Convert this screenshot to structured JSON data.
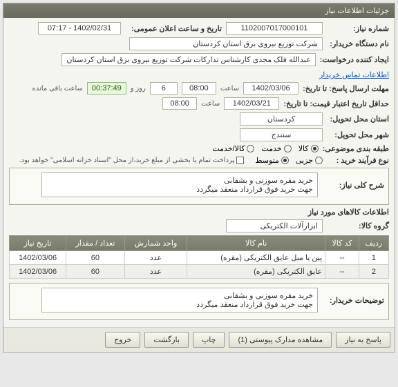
{
  "panel_title": "جزئیات اطلاعات نیاز",
  "fields": {
    "need_no_label": "شماره نیاز:",
    "need_no": "1102007017000101",
    "announce_label": "تاریخ و ساعت اعلان عمومی:",
    "announce_value": "1402/02/31 - 07:17",
    "buyer_label": "نام دستگاه خریدار:",
    "buyer_value": "شرکت توزیع نیروی برق استان کردستان",
    "requester_label": "ایجاد کننده درخواست:",
    "requester_value": "عبدالله فلک مجدی کارشناس تدارکات شرکت توزیع نیروی برق استان کردستان",
    "contact_link": "اطلاعات تماس خریدار",
    "deadline_label": "مهلت ارسال پاسخ: تا تاریخ:",
    "deadline_date": "1402/03/06",
    "time_label": "ساعت",
    "deadline_time": "08:00",
    "days_num": "6",
    "days_label": "روز و",
    "countdown": "00:37:49",
    "remaining": "ساعت باقی مانده",
    "validity_label": "حداقل تاریخ اعتبار قیمت: تا تاریخ:",
    "validity_date": "1402/03/21",
    "validity_time": "08:00",
    "province_label": "استان محل تحویل:",
    "province_value": "کردستان",
    "city_label": "شهر محل تحویل:",
    "city_value": "سنندج",
    "category_label": "طبقه بندی موضوعی:",
    "cat_goods": "کالا",
    "cat_service": "خدمت",
    "cat_goods_service": "کالا/خدمت",
    "process_label": "نوع فرآیند خرید :",
    "proc_small": "جزیی",
    "proc_medium": "متوسط",
    "payment_note": "پرداخت تمام یا بخشی از مبلغ خرید،از محل \"اسناد خزانه اسلامی\" خواهد بود.",
    "desc_label": "شرح کلی نیاز:",
    "desc_text": "خرید مقره سوزنی و بشقابی\nجهت خرید فوق قرارداد منعقد میگردد",
    "group_label": "گروه کالا:",
    "group_value": "ابزارآلات الکتریکی",
    "items_title": "اطلاعات کالاهای مورد نیاز",
    "buyer_notes_label": "توضیحات خریدار:",
    "buyer_notes_text": "خرید مقره سوزنی و بشقابی\nجهت خرید فوق قرارداد منعقد میگردد"
  },
  "table": {
    "headers": {
      "row": "ردیف",
      "code": "کد کالا",
      "name": "نام کالا",
      "unit": "واحد شمارش",
      "qty": "تعداد / مقدار",
      "date": "تاریخ نیاز"
    },
    "rows": [
      {
        "row": "1",
        "code": "--",
        "name": "پین یا میل عایق الکتریکی (مقره)",
        "unit": "عدد",
        "qty": "60",
        "date": "1402/03/06"
      },
      {
        "row": "2",
        "code": "--",
        "name": "عایق الکتریکی (مقره)",
        "unit": "عدد",
        "qty": "60",
        "date": "1402/03/06"
      }
    ]
  },
  "buttons": {
    "respond": "پاسخ به نیاز",
    "attachments": "مشاهده مدارک پیوستی (1)",
    "print": "چاپ",
    "back": "بازگشت",
    "exit": "خروج"
  }
}
